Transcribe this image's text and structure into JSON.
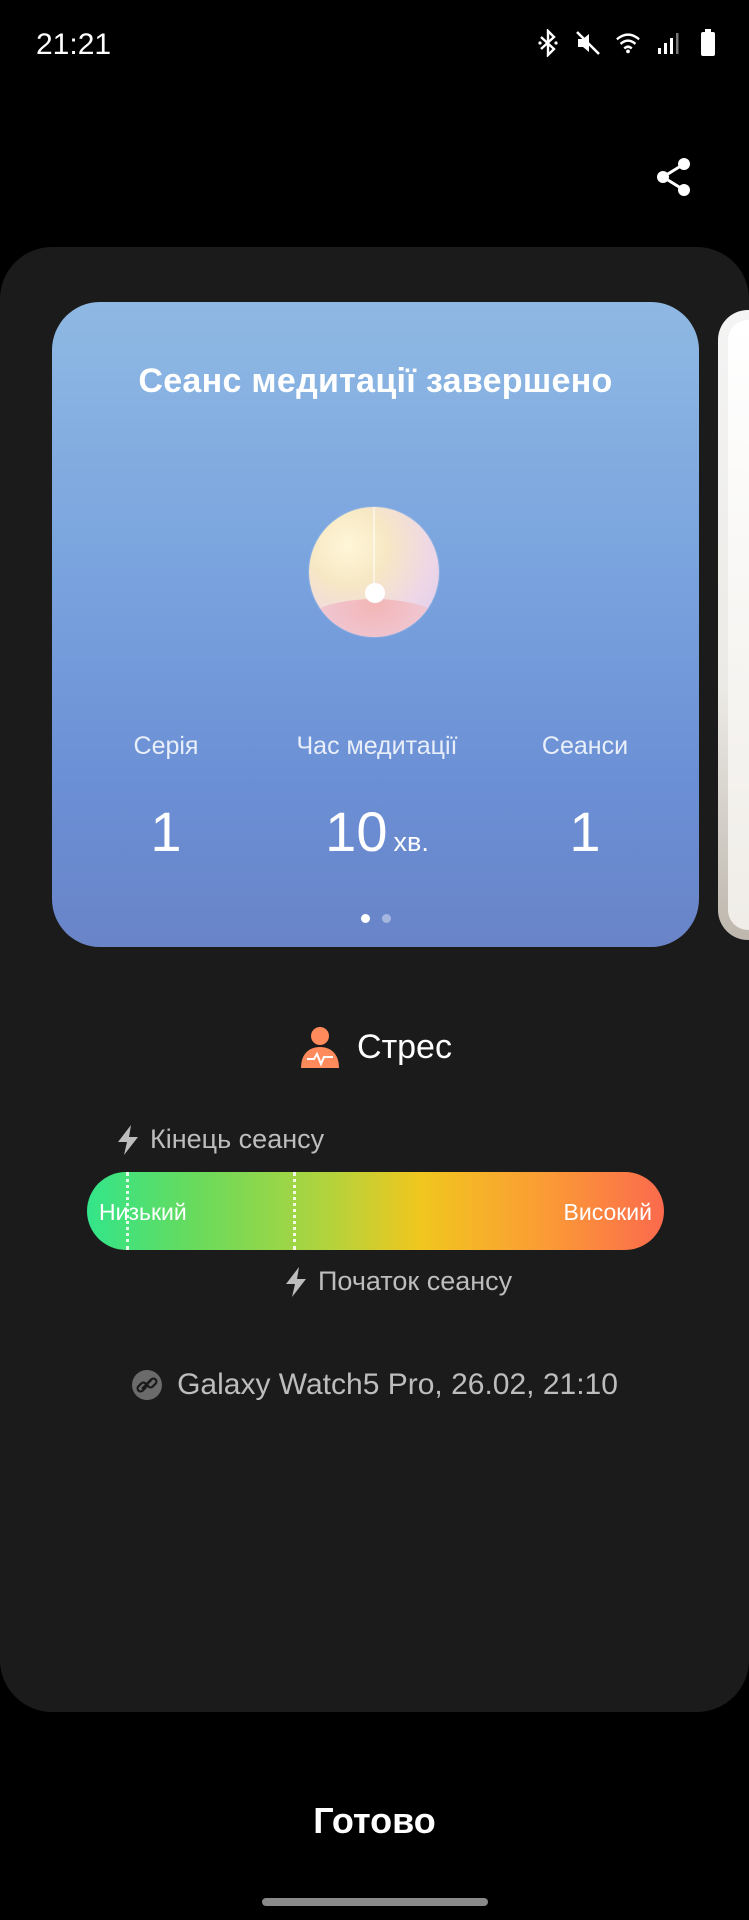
{
  "status_bar": {
    "time": "21:21",
    "icons": [
      "bluetooth-icon",
      "mute-icon",
      "wifi-icon",
      "signal-icon",
      "battery-icon"
    ]
  },
  "header": {
    "share_icon": "share-icon"
  },
  "meditation_card": {
    "title": "Сеанс медитації завершено",
    "stats": [
      {
        "label": "Серія",
        "value": "1",
        "unit": ""
      },
      {
        "label": "Час медитації",
        "value": "10",
        "unit": "хв."
      },
      {
        "label": "Сеанси",
        "value": "1",
        "unit": ""
      }
    ],
    "pager": {
      "total": 2,
      "active": 0
    }
  },
  "stress": {
    "title": "Стрес",
    "icon": "stress-person-icon",
    "end_marker_label": "Кінець сеансу",
    "start_marker_label": "Початок сеансу",
    "low_label": "Низький",
    "high_label": "Високий",
    "colors": {
      "low": "#33e58a",
      "mid": "#f1c61e",
      "high": "#fb6a4d"
    }
  },
  "device": {
    "icon": "link-icon",
    "text": "Galaxy Watch5 Pro, 26.02, 21:10"
  },
  "footer": {
    "done_label": "Готово"
  }
}
